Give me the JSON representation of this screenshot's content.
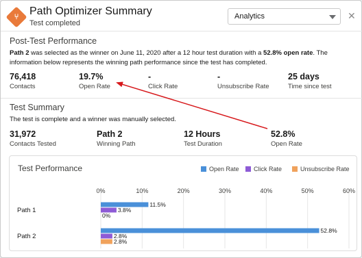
{
  "header": {
    "title": "Path Optimizer Summary",
    "subtitle": "Test completed",
    "view_select": "Analytics"
  },
  "post_test": {
    "heading": "Post-Test Performance",
    "winner": "Path 2",
    "sentence_mid": " was selected as the winner on June 11, 2020 after a 12 hour test duration with a ",
    "winning_metric": "52.8% open rate",
    "sentence_end": ". The information below represents the winning path performance since the test has completed.",
    "stats": [
      {
        "value": "76,418",
        "label": "Contacts"
      },
      {
        "value": "19.7%",
        "label": "Open Rate"
      },
      {
        "value": "-",
        "label": "Click Rate"
      },
      {
        "value": "-",
        "label": "Unsubscribe Rate"
      },
      {
        "value": "25 days",
        "label": "Time since test"
      }
    ]
  },
  "test_summary": {
    "heading": "Test Summary",
    "description": "The test is complete and a winner was manually selected.",
    "stats": [
      {
        "value": "31,972",
        "label": "Contacts Tested"
      },
      {
        "value": "Path 2",
        "label": "Winning Path"
      },
      {
        "value": "12 Hours",
        "label": "Test Duration"
      },
      {
        "value": "52.8%",
        "label": "Open Rate"
      }
    ]
  },
  "colors": {
    "open_rate": "#4a90d9",
    "click_rate": "#8e5bd6",
    "unsubscribe_rate": "#f0a25c",
    "annotation_arrow": "#d7191c",
    "app_icon": "#e97a3a"
  },
  "chart_data": {
    "type": "bar",
    "orientation": "horizontal",
    "title": "Test Performance",
    "categories": [
      "Path 1",
      "Path 2"
    ],
    "x_ticks": [
      "0%",
      "10%",
      "20%",
      "30%",
      "40%",
      "50%",
      "60%"
    ],
    "xlim": [
      0,
      60
    ],
    "grid": true,
    "legend_position": "top-right",
    "series": [
      {
        "name": "Open Rate",
        "values": [
          11.5,
          52.8
        ],
        "labels": [
          "11.5%",
          "52.8%"
        ]
      },
      {
        "name": "Click Rate",
        "values": [
          3.8,
          2.8
        ],
        "labels": [
          "3.8%",
          "2.8%"
        ]
      },
      {
        "name": "Unsubscribe Rate",
        "values": [
          0,
          2.8
        ],
        "labels": [
          "0%",
          "2.8%"
        ]
      }
    ]
  }
}
